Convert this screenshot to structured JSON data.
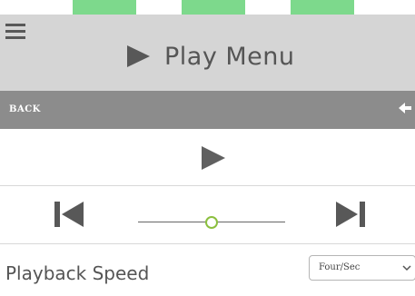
{
  "header": {
    "title": "Play Menu",
    "menu_icon": "hamburger-menu-icon",
    "title_icon": "play-icon"
  },
  "back_bar": {
    "label": "BACK",
    "icon": "arrow-left-icon"
  },
  "player": {
    "play_icon": "play-icon",
    "prev_icon": "skip-previous-icon",
    "next_icon": "skip-next-icon",
    "position_fraction": 0.5
  },
  "speed": {
    "label": "Playback Speed",
    "selected_value": "Four/Sec",
    "dropdown_icon": "chevron-down-icon"
  },
  "colors": {
    "header_bg": "#d5d5d5",
    "back_bar_bg": "#8c8c8c",
    "icon_gray": "#555555",
    "slider_accent": "#8bbf3f",
    "tab_green": "#7dd98c"
  }
}
